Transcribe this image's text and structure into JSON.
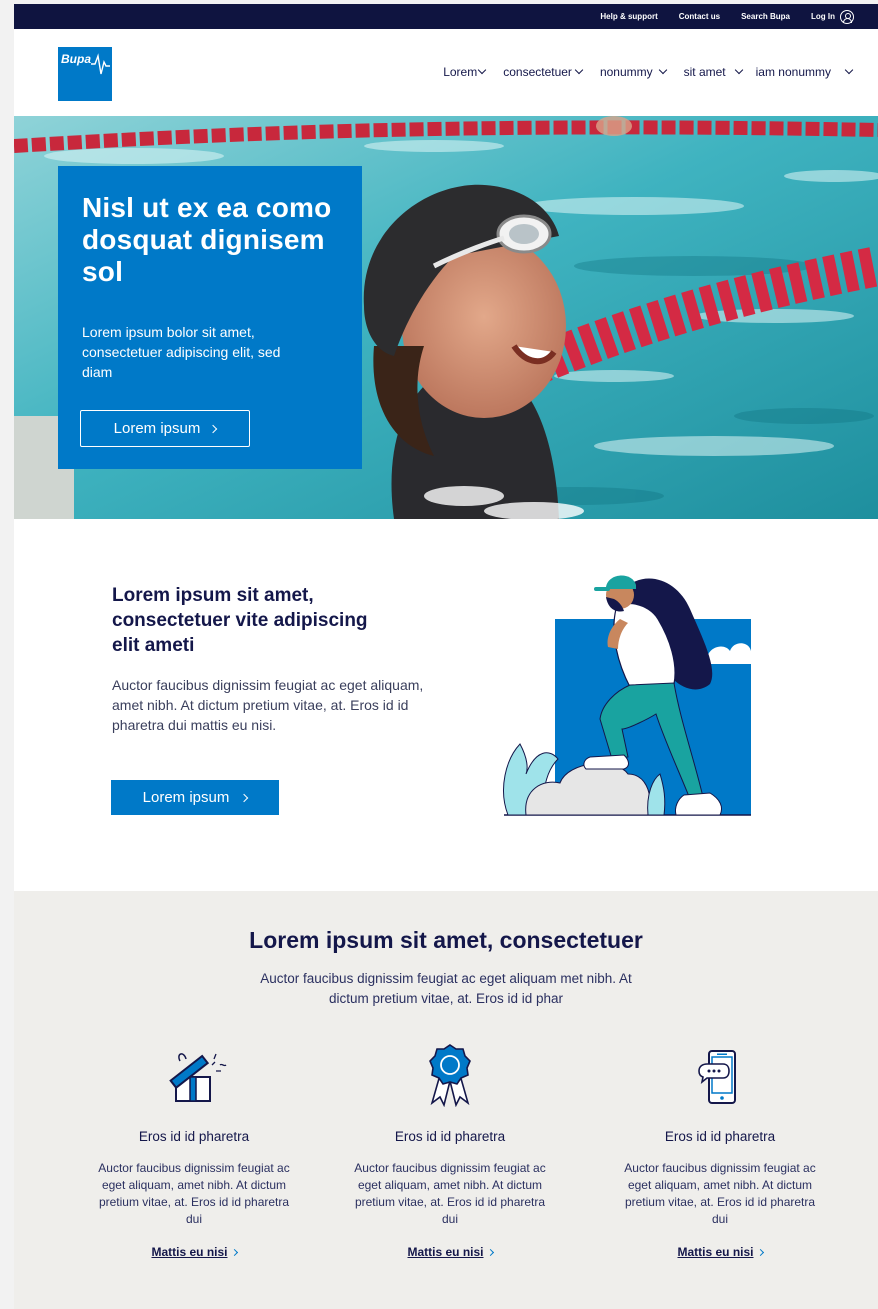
{
  "utility": {
    "help": "Help & support",
    "contact": "Contact us",
    "search": "Search Bupa",
    "login": "Log In"
  },
  "logo": {
    "text": "Bupa"
  },
  "nav": [
    {
      "label": "Lorem"
    },
    {
      "label": "consectetuer"
    },
    {
      "label": "nonummy"
    },
    {
      "label": "sit amet"
    },
    {
      "label": "iam nonummy"
    }
  ],
  "hero": {
    "title": "Nisl ut ex ea como dosquat dignisem sol",
    "text": "Lorem ipsum bolor sit amet, consectetuer adipiscing elit, sed diam",
    "button": "Lorem ipsum"
  },
  "intro": {
    "title": "Lorem ipsum sit amet, consectetuer vite adipiscing elit ameti",
    "text": "Auctor faucibus dignissim feugiat ac eget aliquam, amet nibh. At dictum pretium vitae, at. Eros id id pharetra dui mattis eu nisi.",
    "button": "Lorem ipsum"
  },
  "features": {
    "title": "Lorem ipsum sit amet, consectetuer",
    "subtitle": "Auctor faucibus dignissim feugiat ac eget aliquam met nibh. At dictum pretium vitae, at. Eros id id phar",
    "items": [
      {
        "icon": "gift-icon",
        "title": "Eros id id pharetra",
        "text": "Auctor faucibus dignissim feugiat ac eget aliquam, amet nibh. At dictum pretium vitae, at. Eros id id pharetra dui",
        "link": "Mattis eu nisi"
      },
      {
        "icon": "award-ribbon-icon",
        "title": "Eros id id pharetra",
        "text": "Auctor faucibus dignissim feugiat ac eget aliquam, amet nibh. At dictum pretium vitae, at. Eros id id pharetra dui",
        "link": "Mattis eu nisi"
      },
      {
        "icon": "phone-chat-icon",
        "title": "Eros id id pharetra",
        "text": "Auctor faucibus dignissim feugiat ac eget aliquam, amet nibh. At dictum pretium vitae, at. Eros id id pharetra dui",
        "link": "Mattis eu nisi"
      }
    ]
  },
  "colors": {
    "navy": "#0f1440",
    "brand_blue": "#0079c8",
    "text_navy": "#14174a",
    "feature_bg": "#efeeeb"
  }
}
